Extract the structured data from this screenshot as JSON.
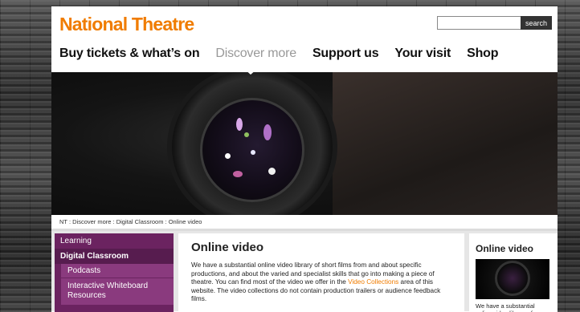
{
  "header": {
    "logo": "National Theatre",
    "search": {
      "placeholder": "",
      "button_label": "search"
    }
  },
  "nav": {
    "items": [
      {
        "label": "Buy tickets & what’s on"
      },
      {
        "label": "Discover more",
        "active": true
      },
      {
        "label": "Support us"
      },
      {
        "label": "Your visit"
      },
      {
        "label": "Shop"
      }
    ]
  },
  "breadcrumb": "NT : Discover more : Digital Classroom : Online video",
  "sidebar": {
    "items": [
      {
        "label": "Learning"
      },
      {
        "label": "Digital Classroom"
      }
    ],
    "subitems": [
      {
        "label": "Podcasts"
      },
      {
        "label": "Interactive Whiteboard Resources"
      }
    ]
  },
  "main": {
    "title": "Online video",
    "body_start": "We have a substantial online video library of short films from and about specific productions, and about the varied and specialist skills that go into making a piece of theatre. You can find most of the video we offer in the ",
    "body_link": "Video Collections",
    "body_end": " area of this website. The video collections do not contain production trailers or audience feedback films."
  },
  "right": {
    "title": "Online video",
    "text": "We have a substantial online video library of"
  },
  "colors": {
    "brand_orange": "#f07c00",
    "sidebar_purple": "#6b2360"
  }
}
